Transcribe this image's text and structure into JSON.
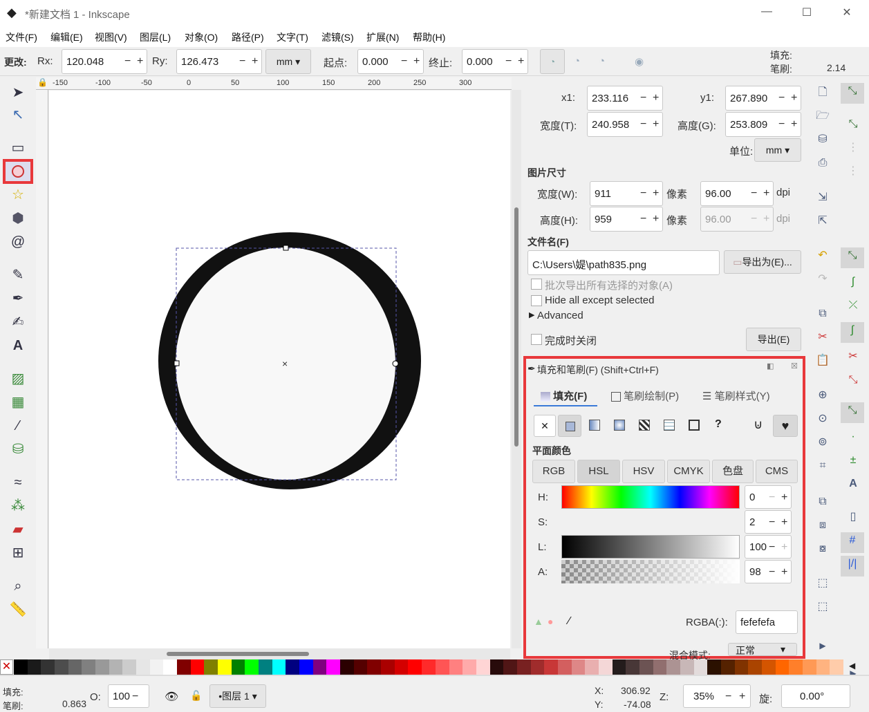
{
  "window": {
    "title": "*新建文档 1 - Inkscape",
    "min": "—",
    "max": "☐",
    "close": "✕"
  },
  "menu": [
    "文件(F)",
    "编辑(E)",
    "视图(V)",
    "图层(L)",
    "对象(O)",
    "路径(P)",
    "文字(T)",
    "滤镜(S)",
    "扩展(N)",
    "帮助(H)"
  ],
  "toolbar": {
    "change_label": "更改:",
    "rx_label": "Rx:",
    "rx": "120.048",
    "ry_label": "Ry:",
    "ry": "126.473",
    "unit": "mm",
    "start_label": "起点:",
    "start": "0.000",
    "end_label": "终止:",
    "end": "0.000",
    "fill_label": "填充:",
    "stroke_label": "笔刷:",
    "stroke_width": "2.14"
  },
  "ruler": {
    "ticks": [
      "-150",
      "-100",
      "-50",
      "0",
      "50",
      "100",
      "150",
      "200",
      "250",
      "300"
    ]
  },
  "export": {
    "x1_label": "x1:",
    "x1": "233.116",
    "y1_label": "y1:",
    "y1": "267.890",
    "width_label": "宽度(T):",
    "width": "240.958",
    "height_label": "高度(G):",
    "height": "253.809",
    "unit_label": "单位:",
    "unit": "mm",
    "image_size": "图片尺寸",
    "w_label": "宽度(W):",
    "w_px": "911",
    "px1": "像素",
    "dpi_val": "96.00",
    "dpi": "dpi",
    "h_label": "高度(H):",
    "h_px": "959",
    "px2": "像素",
    "dpi_val2": "96.00",
    "dpi2": "dpi",
    "filename_label": "文件名(F)",
    "filename": "C:\\Users\\媞\\path835.png",
    "export_as": "导出为(E)...",
    "batch": "批次导出所有选择的对象(A)",
    "hide_all": "Hide all except selected",
    "advanced": "Advanced",
    "close_when_done": "完成时关闭",
    "export_btn": "导出(E)"
  },
  "fill": {
    "title": "填充和笔刷(F) (Shift+Ctrl+F)",
    "tabs": [
      "填充(F)",
      "笔刷绘制(P)",
      "笔刷样式(Y)"
    ],
    "flat": "平面颜色",
    "modes": [
      "RGB",
      "HSL",
      "HSV",
      "CMYK",
      "色盘",
      "CMS"
    ],
    "h_label": "H:",
    "h": "0",
    "s_label": "S:",
    "s": "2",
    "l_label": "L:",
    "l": "100",
    "a_label": "A:",
    "a": "98",
    "rgba_label": "RGBA(:):",
    "rgba": "fefefefa",
    "blend_label": "混合模式:",
    "blend": "正常",
    "unknown": "?"
  },
  "status": {
    "fill_label": "填充:",
    "stroke_label": "笔刷:",
    "stroke_w": "0.863",
    "o_label": "O:",
    "opacity": "100",
    "layer": "•图层 1",
    "x_label": "X:",
    "x": "306.92",
    "y_label": "Y:",
    "y": "-74.08",
    "z_label": "Z:",
    "zoom": "35%",
    "rot_label": "旋:",
    "rot": "0.00°"
  },
  "palette": [
    "#000000",
    "#1a1a1a",
    "#333333",
    "#4d4d4d",
    "#666666",
    "#808080",
    "#999999",
    "#b3b3b3",
    "#cccccc",
    "#e6e6e6",
    "#f2f2f2",
    "#ffffff",
    "#800000",
    "#ff0000",
    "#808000",
    "#ffff00",
    "#008000",
    "#00ff00",
    "#008080",
    "#00ffff",
    "#000080",
    "#0000ff",
    "#800080",
    "#ff00ff",
    "#2b0000",
    "#550000",
    "#800000",
    "#aa0000",
    "#d40000",
    "#ff0000",
    "#ff2a2a",
    "#ff5555",
    "#ff8080",
    "#ffaaaa",
    "#ffd5d5",
    "#280b0b",
    "#501616",
    "#782121",
    "#a02c2c",
    "#c83737",
    "#d35f5f",
    "#de8787",
    "#e9afaf",
    "#f4d7d7",
    "#241c1c",
    "#483737",
    "#6c5353",
    "#916f6f",
    "#ac9393",
    "#c8b7b7",
    "#e3dbdb",
    "#2b1100",
    "#552200",
    "#803300",
    "#aa4400",
    "#d45500",
    "#ff6600",
    "#ff7f2a",
    "#ff9955",
    "#ffb380",
    "#ffccaa"
  ]
}
